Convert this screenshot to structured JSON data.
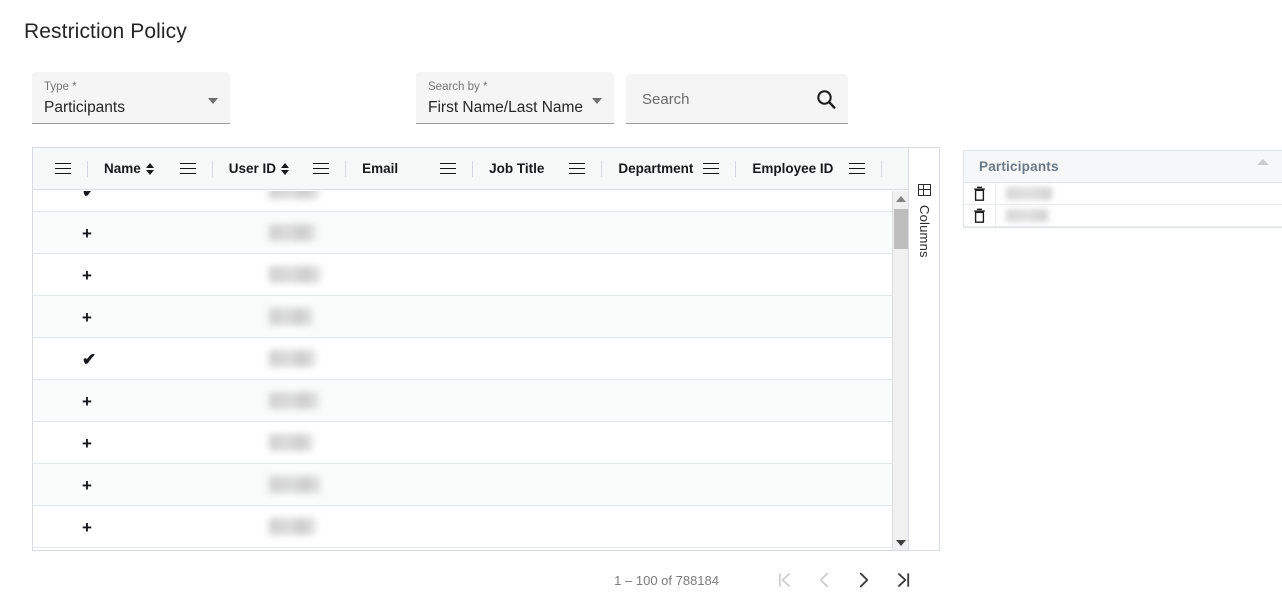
{
  "page": {
    "title": "Restriction Policy"
  },
  "filters": {
    "type": {
      "label": "Type *",
      "value": "Participants",
      "icon": "chevron-down-icon"
    },
    "search_by": {
      "label": "Search by *",
      "value": "First Name/Last Name",
      "icon": "chevron-down-icon"
    },
    "search_input": {
      "placeholder": "Search",
      "value": "",
      "icon": "search-icon"
    },
    "search_button": {
      "label": "Search",
      "disabled": true,
      "bg": "#e0e0e0",
      "text_color": "#a8a8a8"
    }
  },
  "table": {
    "columns": [
      {
        "label": "Name",
        "sortable": true,
        "menu_icon": "hamburger-menu-icon"
      },
      {
        "label": "User ID",
        "sortable": true,
        "menu_icon": "hamburger-menu-icon"
      },
      {
        "label": "Email",
        "sortable": false,
        "menu_icon": "hamburger-menu-icon"
      },
      {
        "label": "Job Title",
        "sortable": false,
        "menu_icon": "hamburger-menu-icon"
      },
      {
        "label": "Department",
        "sortable": false,
        "menu_icon": "hamburger-menu-icon"
      },
      {
        "label": "Employee ID",
        "sortable": false,
        "menu_icon": "hamburger-menu-icon"
      }
    ],
    "rows": [
      {
        "action": "check",
        "action_glyph": "✔",
        "user_id": "[redacted]"
      },
      {
        "action": "add",
        "action_glyph": "+",
        "user_id": "[redacted]"
      },
      {
        "action": "add",
        "action_glyph": "+",
        "user_id": "[redacted]"
      },
      {
        "action": "add",
        "action_glyph": "+",
        "user_id": "[redacted]"
      },
      {
        "action": "check",
        "action_glyph": "✔",
        "user_id": "[redacted]"
      },
      {
        "action": "add",
        "action_glyph": "+",
        "user_id": "[redacted]"
      },
      {
        "action": "add",
        "action_glyph": "+",
        "user_id": "[redacted]"
      },
      {
        "action": "add",
        "action_glyph": "+",
        "user_id": "[redacted]"
      },
      {
        "action": "add",
        "action_glyph": "+",
        "user_id": "[redacted]"
      }
    ],
    "columns_tab": {
      "label": "Columns",
      "icon": "table-grid-icon"
    },
    "scrollbar": {
      "up_icon": "scroll-up-arrow-icon",
      "down_icon": "scroll-down-arrow-icon"
    }
  },
  "paginator": {
    "range_label": "1 – 100 of 788184",
    "first": {
      "glyph": "|<",
      "label": "First page",
      "enabled": false
    },
    "prev": {
      "glyph": "<",
      "label": "Previous page",
      "enabled": false
    },
    "next": {
      "glyph": ">",
      "label": "Next page",
      "enabled": true
    },
    "last": {
      "glyph": ">|",
      "label": "Last page",
      "enabled": true
    }
  },
  "side_panel": {
    "title": "Participants",
    "title_color": "#6b7885",
    "collapse_icon": "chevron-up-icon",
    "rows": [
      {
        "delete_icon": "trash-icon",
        "name": "[redacted]"
      },
      {
        "delete_icon": "trash-icon",
        "name": "[redacted]"
      }
    ]
  }
}
